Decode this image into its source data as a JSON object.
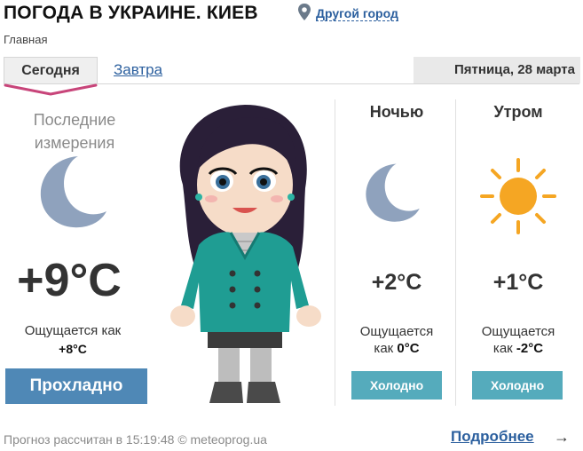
{
  "header": {
    "title": "ПОГОДА В УКРАИНЕ. КИЕВ",
    "other_city": "Другой город",
    "breadcrumb": "Главная"
  },
  "tabs": {
    "today": "Сегодня",
    "tomorrow": "Завтра",
    "date": "Пятница, 28 марта"
  },
  "current": {
    "label_line1": "Последние",
    "label_line2": "измерения",
    "temp": "+9°C",
    "feels_label": "Ощущается как",
    "feels_value": "+8°C",
    "condition": "Прохладно",
    "icon": "moon-icon"
  },
  "periods": [
    {
      "title": "Ночью",
      "icon": "moon-icon",
      "temp": "+2°C",
      "feels_line1": "Ощущается",
      "feels_prefix": "как",
      "feels_value": "0°C",
      "condition": "Холодно"
    },
    {
      "title": "Утром",
      "icon": "sun-icon",
      "temp": "+1°C",
      "feels_line1": "Ощущается",
      "feels_prefix": "как",
      "feels_value": "-2°C",
      "condition": "Холодно"
    }
  ],
  "footer": {
    "note": "Прогноз рассчитан в 15:19:48 © meteoprog.ua",
    "more": "Подробнее",
    "arrow": "→"
  },
  "colors": {
    "link": "#2b5f9e",
    "cool_button": "#4f88b6",
    "cold_button": "#55abbc",
    "tab_accent": "#c8457a",
    "moon": "#8fa2bd",
    "sun": "#f5a623"
  }
}
